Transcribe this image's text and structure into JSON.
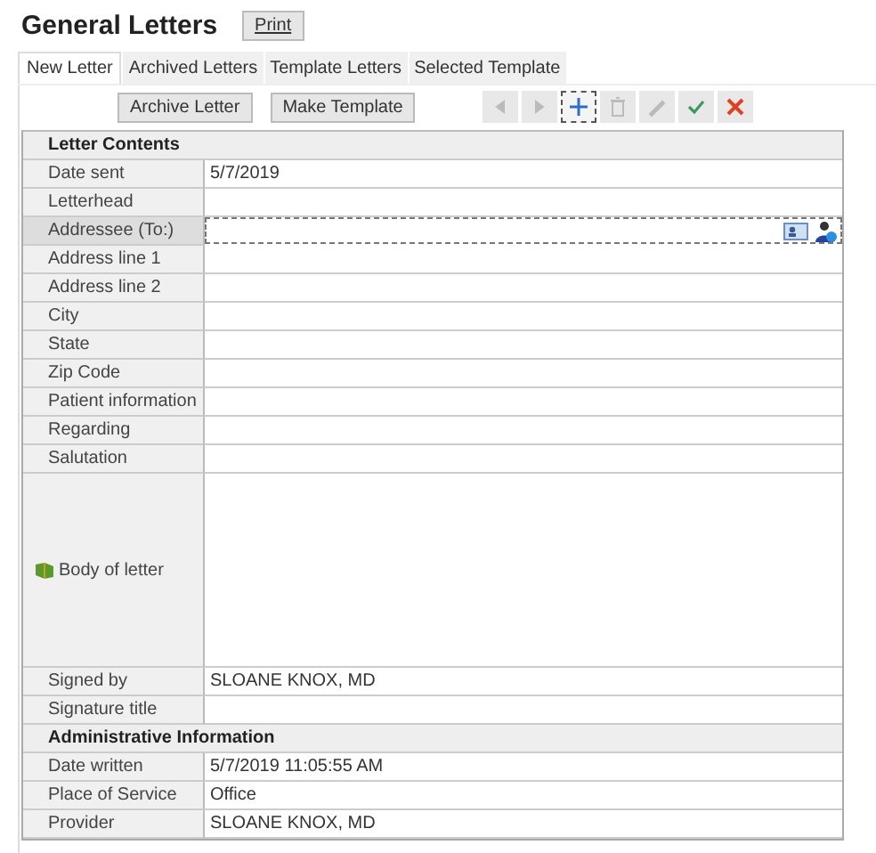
{
  "title": "General Letters",
  "print_button": "Print",
  "tabs": [
    {
      "label": "New Letter",
      "selected": true
    },
    {
      "label": "Archived Letters",
      "selected": false
    },
    {
      "label": "Template Letters",
      "selected": false
    },
    {
      "label": "Selected Template",
      "selected": false
    }
  ],
  "action_buttons": [
    "Archive Letter",
    "Make Template"
  ],
  "icon_buttons": [
    {
      "kind": "previous",
      "disabled": true,
      "focused": false
    },
    {
      "kind": "next",
      "disabled": true,
      "focused": false
    },
    {
      "kind": "add",
      "disabled": false,
      "focused": true
    },
    {
      "kind": "delete",
      "disabled": true,
      "focused": false
    },
    {
      "kind": "edit",
      "disabled": true,
      "focused": false
    },
    {
      "kind": "save",
      "disabled": false,
      "focused": false
    },
    {
      "kind": "cancel",
      "disabled": false,
      "focused": false
    }
  ],
  "rows": [
    {
      "kind": "section",
      "label": "Letter Contents"
    },
    {
      "kind": "field",
      "label": "Date sent",
      "value": "5/7/2019"
    },
    {
      "kind": "field",
      "label": "Letterhead"
    },
    {
      "kind": "lookup",
      "label": "Addressee (To:)",
      "focused": true
    },
    {
      "kind": "field",
      "label": "Address line 1"
    },
    {
      "kind": "field",
      "label": "Address line 2"
    },
    {
      "kind": "field",
      "label": "City"
    },
    {
      "kind": "field",
      "label": "State"
    },
    {
      "kind": "field",
      "label": "Zip Code"
    },
    {
      "kind": "field",
      "label": "Patient information"
    },
    {
      "kind": "field",
      "label": "Regarding"
    },
    {
      "kind": "field",
      "label": "Salutation"
    },
    {
      "kind": "body",
      "label": "Body of letter"
    },
    {
      "kind": "field",
      "label": "Signed by",
      "value": "SLOANE KNOX, MD"
    },
    {
      "kind": "field",
      "label": "Signature title"
    },
    {
      "kind": "section",
      "label": "Administrative Information"
    },
    {
      "kind": "field",
      "label": "Date written",
      "value": "5/7/2019 11:05:55 AM"
    },
    {
      "kind": "field",
      "label": "Place of Service",
      "value": "Office"
    },
    {
      "kind": "field",
      "label": "Provider",
      "value": "SLOANE KNOX, MD"
    }
  ]
}
